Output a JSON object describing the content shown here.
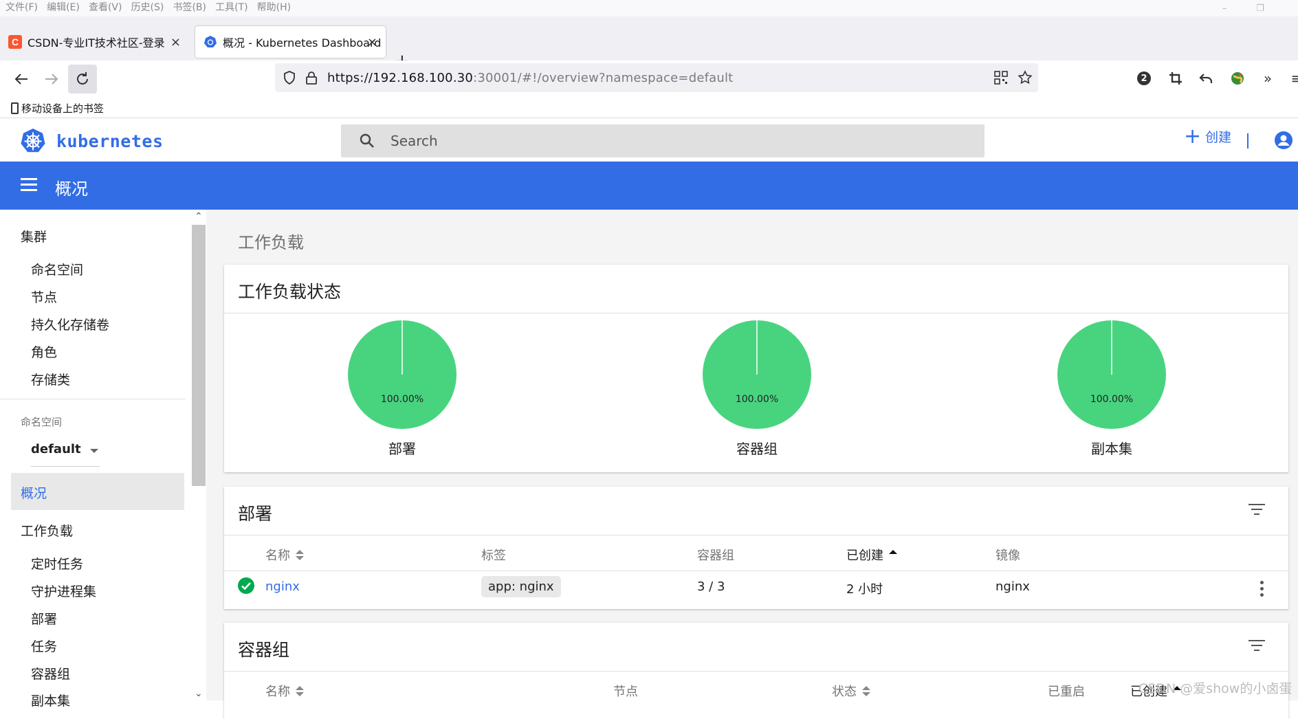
{
  "browser": {
    "menu": [
      "文件(F)",
      "编辑(E)",
      "查看(V)",
      "历史(S)",
      "书签(B)",
      "工具(T)",
      "帮助(H)"
    ],
    "tabs": [
      {
        "title": "CSDN-专业IT技术社区-登录",
        "favicon": "C",
        "color": "#fc5531"
      },
      {
        "title": "概况 - Kubernetes Dashboard",
        "favicon": "k8s-wheel-icon",
        "color": "#326de6"
      }
    ],
    "url_host": "https://192.168.100.30",
    "url_rest": ":30001/#!/overview?namespace=default",
    "bookmark": "移动设备上的书签",
    "extension_badge": "2"
  },
  "header": {
    "brand": "kubernetes",
    "search_placeholder": "Search",
    "create_label": "创建"
  },
  "titlebar": {
    "title": "概况"
  },
  "sidebar": {
    "cluster_heading": "集群",
    "cluster_items": [
      "命名空间",
      "节点",
      "持久化存储卷",
      "角色",
      "存储类"
    ],
    "namespace_label": "命名空间",
    "namespace_value": "default",
    "overview": "概况",
    "workloads_heading": "工作负载",
    "workload_items": [
      "定时任务",
      "守护进程集",
      "部署",
      "任务",
      "容器组",
      "副本集"
    ]
  },
  "main": {
    "section_title": "工作负载",
    "status_card": {
      "title": "工作负载状态",
      "charts": [
        {
          "label": "部署",
          "percent": "100.00%"
        },
        {
          "label": "容器组",
          "percent": "100.00%"
        },
        {
          "label": "副本集",
          "percent": "100.00%"
        }
      ],
      "color": "#48d47f"
    },
    "deployments_card": {
      "title": "部署",
      "columns": [
        "名称",
        "标签",
        "容器组",
        "已创建",
        "镜像"
      ],
      "rows": [
        {
          "name": "nginx",
          "label": "app: nginx",
          "pods": "3 / 3",
          "created": "2 小时",
          "image": "nginx"
        }
      ]
    },
    "pods_card": {
      "title": "容器组",
      "columns": [
        "名称",
        "节点",
        "状态",
        "已重启",
        "已创建"
      ]
    }
  },
  "watermark": "CSDN @爱show的小卤蛋"
}
